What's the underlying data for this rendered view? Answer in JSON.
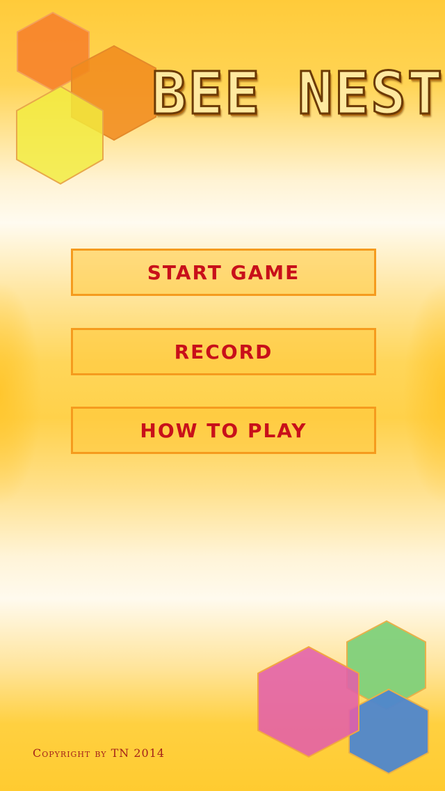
{
  "game": {
    "title": "BEE NEST"
  },
  "menu": {
    "start_label": "START GAME",
    "record_label": "RECORD",
    "how_to_play_label": "HOW TO PLAY"
  },
  "footer": {
    "copyright": "Copyright by TN 2014"
  },
  "colors": {
    "button_text": "#c8101a",
    "button_border": "#f59b1e",
    "hex_orange_red": "#f77f2a",
    "hex_orange": "#f18a1c",
    "hex_yellow": "#f2ec3e",
    "hex_magenta": "#e35faa",
    "hex_green": "#7fd07a",
    "hex_blue": "#4f86cc"
  }
}
